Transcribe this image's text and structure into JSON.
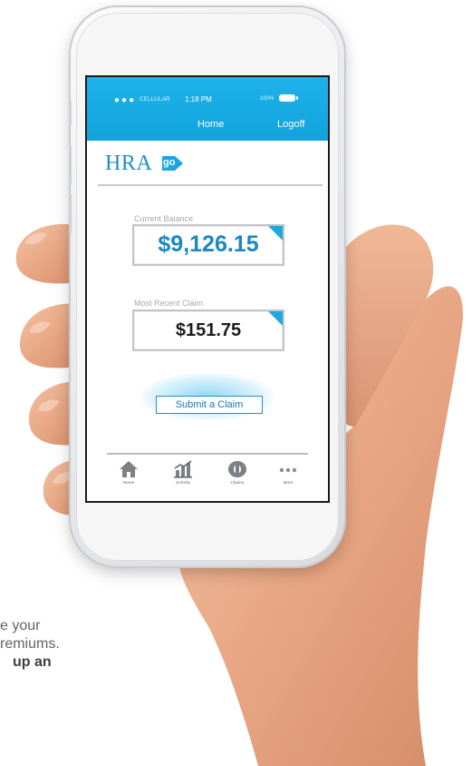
{
  "status_bar": {
    "signal_dots": "●●●",
    "carrier": "CELLULAR",
    "time": "1:18 PM",
    "battery_percent": "100%"
  },
  "nav": {
    "home_label": "Home",
    "logoff_label": "Logoff"
  },
  "brand": {
    "logo_text": "HRA",
    "logo_badge": "go",
    "primary_color": "#1ba6e3"
  },
  "balance": {
    "label": "Current Balance",
    "value": "$9,126.15"
  },
  "recent_claim": {
    "label": "Most Recent Claim",
    "value": "$151.75"
  },
  "actions": {
    "submit_claim_label": "Submit a Claim"
  },
  "tab_bar": {
    "items": [
      {
        "label": "Home",
        "icon": "home-icon"
      },
      {
        "label": "Activity",
        "icon": "activity-chart-icon"
      },
      {
        "label": "Claims",
        "icon": "claims-icon"
      },
      {
        "label": "More",
        "icon": "more-dots-icon"
      }
    ]
  },
  "tagline": {
    "line1": "e your",
    "line2": "remiums.",
    "line3": "up an"
  }
}
